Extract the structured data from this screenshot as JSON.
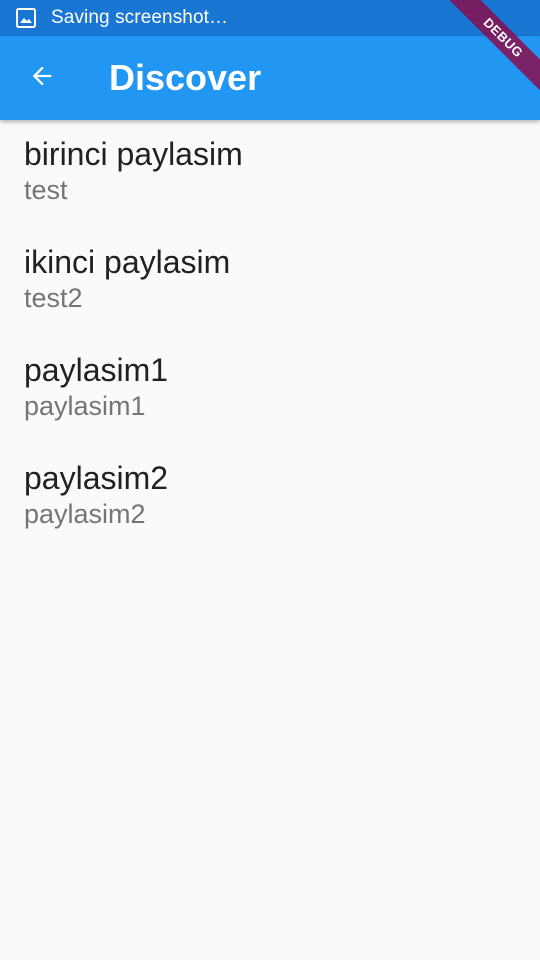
{
  "status_bar": {
    "icon": "image-icon",
    "text": "Saving screenshot…"
  },
  "app_bar": {
    "back_icon": "arrow-back-icon",
    "title": "Discover",
    "background": "#2196f3"
  },
  "list": {
    "items": [
      {
        "title": "birinci paylasim",
        "subtitle": "test"
      },
      {
        "title": "ikinci paylasim",
        "subtitle": "test2"
      },
      {
        "title": "paylasim1",
        "subtitle": "paylasim1"
      },
      {
        "title": "paylasim2",
        "subtitle": "paylasim2"
      }
    ]
  },
  "debug_banner": {
    "label": "DEBUG",
    "color": "#880e4f"
  }
}
